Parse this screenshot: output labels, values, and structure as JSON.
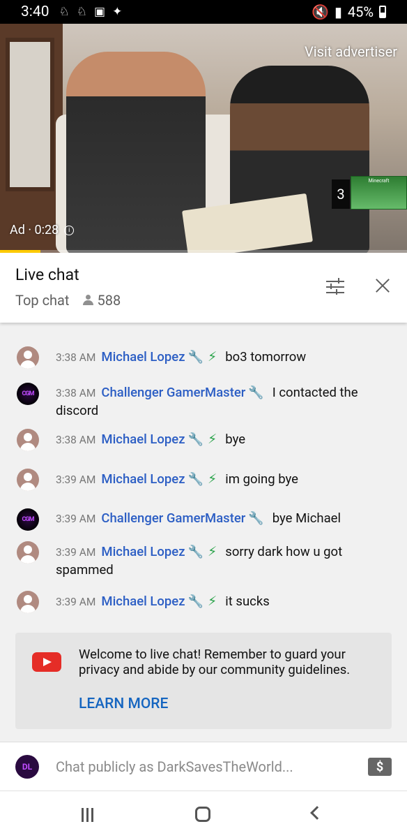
{
  "status_bar": {
    "time": "3:40",
    "battery": "45%",
    "signal_icons": [
      "bell-icon",
      "snapchat-icon",
      "image-icon",
      "twitter-icon"
    ],
    "right_icons": [
      "mute-icon",
      "data-icon",
      "signal-icon"
    ]
  },
  "video": {
    "visit_advertiser": "Visit advertiser",
    "ad_label": "Ad · 0:28",
    "playlist_count": "3",
    "thumbnail_text": "Minecraft",
    "progress": 0.1
  },
  "chat_header": {
    "title": "Live chat",
    "mode": "Top chat",
    "viewer_count": "588"
  },
  "messages": [
    {
      "time": "3:38 AM",
      "author": "Michael Lopez",
      "text": "bye",
      "avatar": "ML",
      "moderator": true,
      "member": true,
      "partial": true
    },
    {
      "time": "3:38 AM",
      "author": "Michael Lopez",
      "text": "bo3 tomorrow",
      "avatar": "ML",
      "moderator": true,
      "member": true
    },
    {
      "time": "3:38 AM",
      "author": "Challenger GamerMaster",
      "text": "I contacted the discord",
      "avatar": "CGM",
      "moderator": true,
      "member": false
    },
    {
      "time": "3:38 AM",
      "author": "Michael Lopez",
      "text": "bye",
      "avatar": "ML",
      "moderator": true,
      "member": true
    },
    {
      "time": "3:39 AM",
      "author": "Michael Lopez",
      "text": "im going bye",
      "avatar": "ML",
      "moderator": true,
      "member": true
    },
    {
      "time": "3:39 AM",
      "author": "Challenger GamerMaster",
      "text": "bye Michael",
      "avatar": "CGM",
      "moderator": true,
      "member": false
    },
    {
      "time": "3:39 AM",
      "author": "Michael Lopez",
      "text": "sorry dark how u got spammed",
      "avatar": "ML",
      "moderator": true,
      "member": true
    },
    {
      "time": "3:39 AM",
      "author": "Michael Lopez",
      "text": "it sucks",
      "avatar": "ML",
      "moderator": true,
      "member": true
    }
  ],
  "welcome": {
    "text": "Welcome to live chat! Remember to guard your privacy and abide by our community guidelines.",
    "learn_more": "LEARN MORE"
  },
  "input": {
    "placeholder": "Chat publicly as DarkSavesTheWorld...",
    "avatar_initials": "DL",
    "superchat_symbol": "$"
  },
  "colors": {
    "author_blue": "#2c5ec4",
    "moderator_wrench": "#3478d6",
    "member_bolt": "#2aa34a",
    "youtube_red": "#e52d27",
    "progress_yellow": "#ffcc00"
  }
}
